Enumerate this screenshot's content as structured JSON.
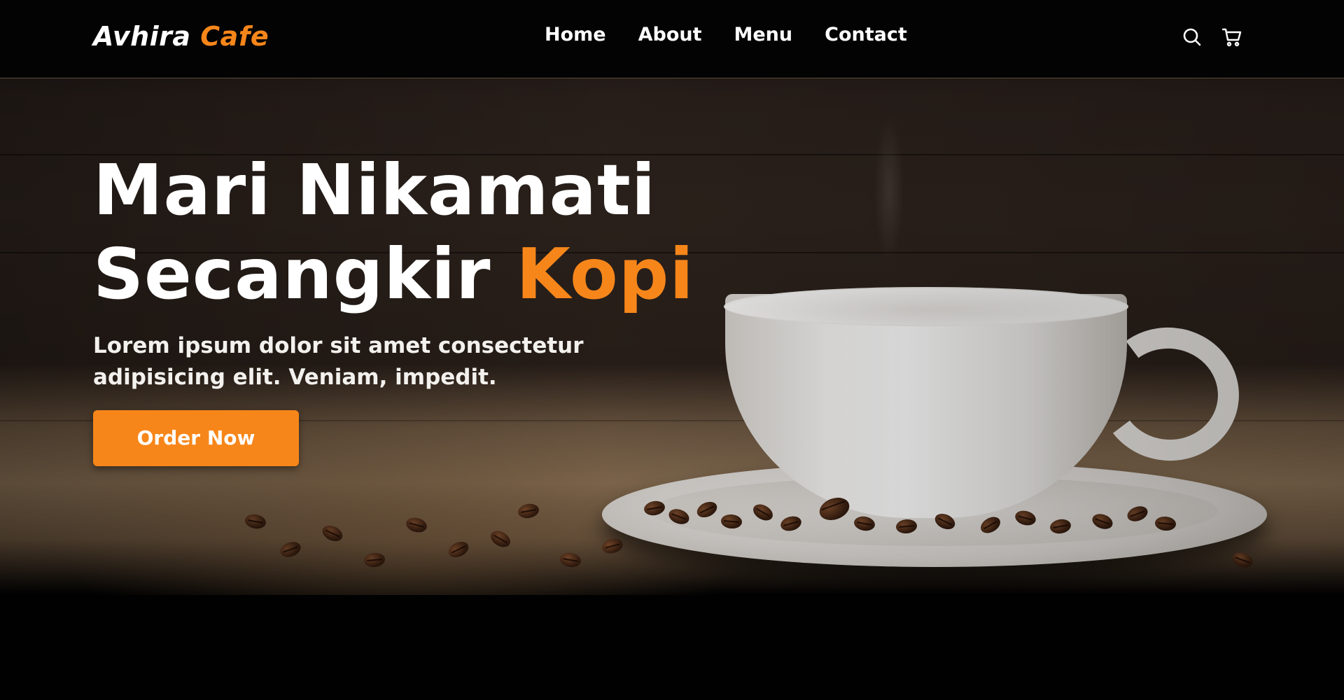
{
  "navbar": {
    "logo": {
      "part1": "Avhira",
      "part2": "Cafe"
    },
    "links": [
      "Home",
      "About",
      "Menu",
      "Contact"
    ],
    "icons": [
      "search-icon",
      "cart-icon"
    ]
  },
  "hero": {
    "headline_line1": "Mari Nikamati",
    "headline_line2_main": "Secangkir",
    "headline_line2_accent": "Kopi",
    "subtext": "Lorem ipsum dolor sit amet consectetur adipisicing elit. Veniam, impedit.",
    "cta_label": "Order Now"
  },
  "colors": {
    "accent": "#f7861a",
    "background": "#010101",
    "text": "#ffffff"
  }
}
